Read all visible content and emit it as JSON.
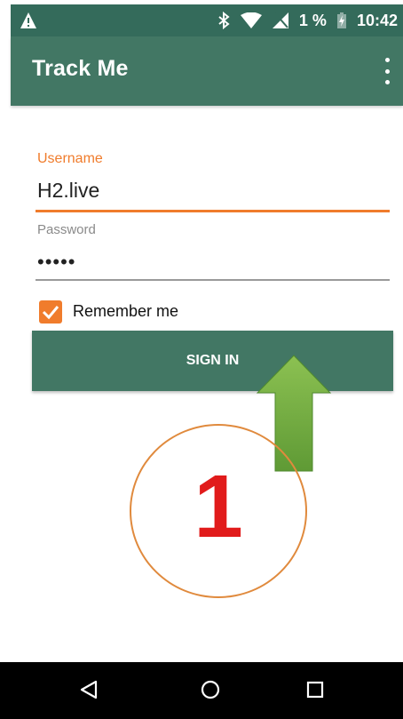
{
  "status_bar": {
    "battery_percent": "1 %",
    "time": "10:42"
  },
  "app_bar": {
    "title": "Track Me"
  },
  "form": {
    "username_label": "Username",
    "username_value": "H2.live",
    "password_label": "Password",
    "password_value": "•••••",
    "remember_me_label": "Remember me",
    "remember_me_checked": true,
    "sign_in_label": "SIGN IN"
  },
  "annotation": {
    "step_number": "1"
  },
  "colors": {
    "primary": "#427764",
    "status_bar": "#346b5b",
    "accent": "#f07c2c",
    "step_number": "#e11b1b",
    "arrow": "#6aaa3b"
  },
  "nav_bar": {
    "icons": [
      "back-icon",
      "home-icon",
      "recents-icon"
    ]
  }
}
